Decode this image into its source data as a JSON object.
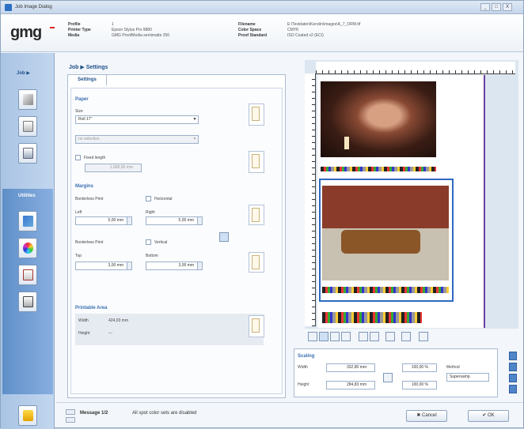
{
  "window": {
    "title": "Job Image Dialog",
    "controls": [
      "_",
      "□",
      "X"
    ]
  },
  "header": {
    "logo": "gmg",
    "left": [
      {
        "label": "Profile",
        "value": "1"
      },
      {
        "label": "Printer Type",
        "value": "Epson Stylus Pro 9880"
      },
      {
        "label": "Media",
        "value": "GMG ProofMedia semimatte 250"
      }
    ],
    "right": [
      {
        "label": "Filename",
        "value": "E:\\Testdaten\\Kerstin\\images\\A_7_ORM.tif"
      },
      {
        "label": "Color Space",
        "value": "CMYK"
      },
      {
        "label": "Proof Standard",
        "value": "ISO Coated v2 (ECI)"
      }
    ]
  },
  "rail": {
    "job_label": "Job ▶",
    "tools_label": "Utilities"
  },
  "breadcrumb": {
    "job": "Job",
    "arrow": "▶",
    "settings": "Settings"
  },
  "tab": {
    "label": "Settings"
  },
  "paper": {
    "section": "Paper",
    "size_label": "Size",
    "size_value": "Roll 17\"",
    "sub_select": "no selection",
    "fixed_length_label": "Fixed length",
    "fixed_length_value": "1.000,00 mm"
  },
  "margins": {
    "section": "Margins",
    "borderless_label": "Borderless Print",
    "horizontal_label": "Horizontal",
    "left_label": "Left",
    "left_value": "5,00 mm",
    "right_label": "Right",
    "right_value": "5,00 mm",
    "borderless2_label": "Borderless Print",
    "vertical_label": "Vertical",
    "top_label": "Top",
    "top_value": "3,00 mm",
    "bottom_label": "Bottom",
    "bottom_value": "3,00 mm"
  },
  "printable": {
    "section": "Printable Area",
    "width_label": "Width",
    "width_value": "424,03 mm",
    "height_label": "Height",
    "height_value": "---"
  },
  "message": {
    "label": "Message 1/2",
    "text": "All spot color sets are disabled"
  },
  "buttons": {
    "cancel": "✖ Cancel",
    "ok": "✔ OK"
  },
  "scaling": {
    "section": "Scaling",
    "width_label": "Width",
    "width_value": "332,80 mm",
    "height_label": "Height",
    "height_value": "284,83 mm",
    "width_pct": "100,00 %",
    "height_pct": "100,00 %",
    "method_label": "Method",
    "method_value": "Supersamp."
  }
}
